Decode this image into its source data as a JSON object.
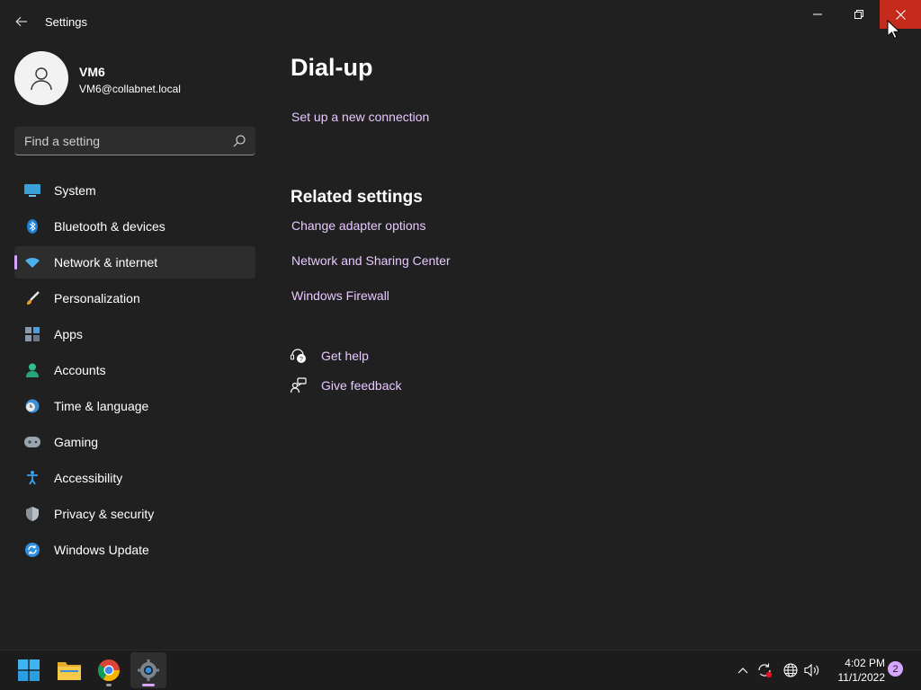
{
  "window": {
    "title": "Settings"
  },
  "profile": {
    "name": "VM6",
    "email": "VM6@collabnet.local"
  },
  "search": {
    "placeholder": "Find a setting"
  },
  "sidebar": {
    "items": [
      {
        "label": "System",
        "icon": "system-icon",
        "active": false
      },
      {
        "label": "Bluetooth & devices",
        "icon": "bluetooth-icon",
        "active": false
      },
      {
        "label": "Network & internet",
        "icon": "wifi-icon",
        "active": true
      },
      {
        "label": "Personalization",
        "icon": "brush-icon",
        "active": false
      },
      {
        "label": "Apps",
        "icon": "apps-icon",
        "active": false
      },
      {
        "label": "Accounts",
        "icon": "account-icon",
        "active": false
      },
      {
        "label": "Time & language",
        "icon": "clock-globe-icon",
        "active": false
      },
      {
        "label": "Gaming",
        "icon": "gamepad-icon",
        "active": false
      },
      {
        "label": "Accessibility",
        "icon": "accessibility-icon",
        "active": false
      },
      {
        "label": "Privacy & security",
        "icon": "shield-icon",
        "active": false
      },
      {
        "label": "Windows Update",
        "icon": "update-icon",
        "active": false
      }
    ]
  },
  "main": {
    "title": "Dial-up",
    "setup_link": "Set up a new connection",
    "related_title": "Related settings",
    "related_links": [
      "Change adapter options",
      "Network and Sharing Center",
      "Windows Firewall"
    ],
    "help": {
      "get_help": "Get help",
      "give_feedback": "Give feedback"
    }
  },
  "taskbar": {
    "apps": [
      "start-icon",
      "file-explorer-icon",
      "chrome-icon",
      "settings-icon"
    ],
    "clock": {
      "time": "4:02 PM",
      "date": "11/1/2022"
    },
    "notification_count": "2"
  },
  "colors": {
    "background": "#202020",
    "accent": "#d6a6ff",
    "link": "#e8c8ff",
    "close_hover": "#c42b1c"
  }
}
